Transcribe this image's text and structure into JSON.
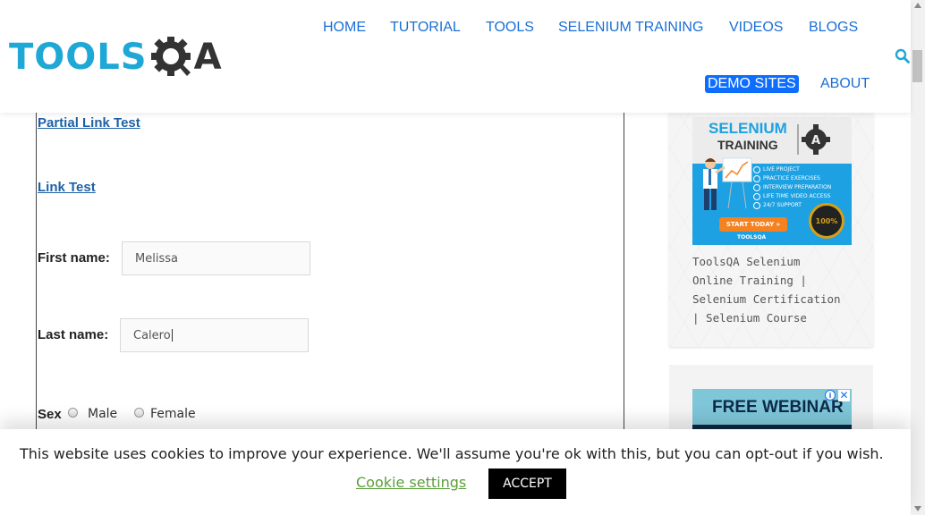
{
  "header": {
    "logo_text_left": "TOOLS",
    "logo_text_right": "A",
    "nav": [
      {
        "label": "HOME"
      },
      {
        "label": "TUTORIAL"
      },
      {
        "label": "TOOLS"
      },
      {
        "label": "SELENIUM TRAINING"
      },
      {
        "label": "VIDEOS"
      },
      {
        "label": "BLOGS"
      },
      {
        "label": "DEMO SITES"
      },
      {
        "label": "ABOUT"
      }
    ],
    "active_nav": "DEMO SITES",
    "search_icon": "search-icon"
  },
  "form": {
    "partial_link": "Partial Link Test",
    "link": "Link Test",
    "first_name_label": "First name:",
    "first_name_value": "Melissa",
    "last_name_label": "Last name:",
    "last_name_value": "Calero",
    "sex_label": "Sex",
    "sex_options": [
      "Male",
      "Female"
    ]
  },
  "sidebar": {
    "promo": {
      "title": "SELENIUM",
      "title2": "TRAINING",
      "items": [
        "LIVE PROJECT",
        "PRACTICE EXERCISES",
        "INTERVIEW PREPARATION",
        "LIFE TIME VIDEO ACCESS",
        "24/7 SUPPORT"
      ],
      "button": "START TODAY »",
      "footer": "TOOLSQA",
      "badge": "100%"
    },
    "caption": "ToolsQA Selenium Online Training | Selenium Certification | Selenium Course",
    "ad": {
      "text": "FREE WEBINAR",
      "info": "i",
      "close": "✕"
    }
  },
  "cookie": {
    "message": "This website uses cookies to improve your experience. We'll assume you're ok with this, but you can opt-out if you wish.",
    "settings": "Cookie settings",
    "accept": "ACCEPT"
  },
  "colors": {
    "brand_blue": "#1fa8d6",
    "nav_blue": "#1a6fd6",
    "active_bg": "#0d6efd",
    "cookie_link": "#5a9e3a"
  }
}
